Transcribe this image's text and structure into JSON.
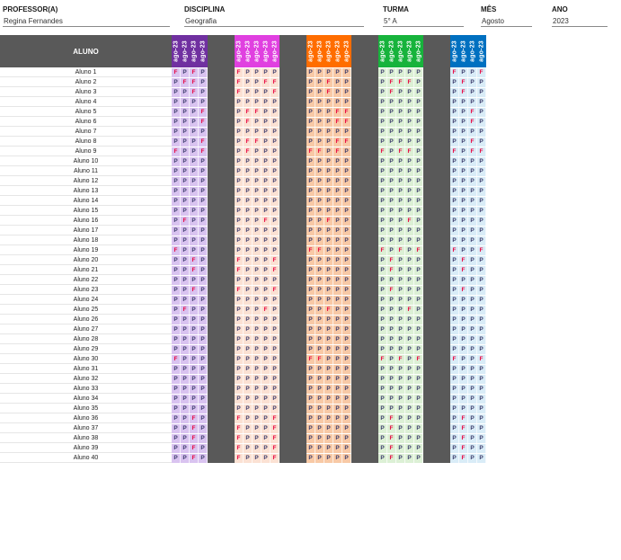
{
  "header": {
    "professor_label": "PROFESSOR(A)",
    "professor_value": "Regina Fernandes",
    "disciplina_label": "DISCIPLINA",
    "disciplina_value": "Geografia",
    "turma_label": "TURMA",
    "turma_value": "5° A",
    "mes_label": "MÊS",
    "mes_value": "Agosto",
    "ano_label": "ANO",
    "ano_value": "2023"
  },
  "grid": {
    "aluno_header": "ALUNO",
    "column_label": "ago-23",
    "groups": [
      {
        "header_color": "#7030a0",
        "cell_color": "#d9c3f0",
        "cols": 4
      },
      {
        "header_color": "#e040e0",
        "cell_color": "#fbe1d3",
        "cols": 5
      },
      {
        "header_color": "#ff6d00",
        "cell_color": "#f8c9a6",
        "cols": 5
      },
      {
        "header_color": "#17b33c",
        "cell_color": "#dcf0d5",
        "cols": 5
      },
      {
        "header_color": "#0070c0",
        "cell_color": "#d9ecf7",
        "cols": 4
      }
    ],
    "students": [
      {
        "name": "Aluno 1",
        "marks": [
          "FPFP",
          "FPPPP",
          "PPPPP",
          "PPPPP",
          "FPPF"
        ]
      },
      {
        "name": "Aluno 2",
        "marks": [
          "PFFP",
          "FPPFF",
          "PPFPP",
          "PFFFP",
          "PFPP"
        ]
      },
      {
        "name": "Aluno 3",
        "marks": [
          "PPFP",
          "FPPPF",
          "PPFPP",
          "PFPPP",
          "PFPP"
        ]
      },
      {
        "name": "Aluno 4",
        "marks": [
          "PPPP",
          "PPPPP",
          "PPPPP",
          "PPPPP",
          "PPPP"
        ]
      },
      {
        "name": "Aluno 5",
        "marks": [
          "PPPF",
          "PFFPP",
          "PPPFF",
          "PPPPP",
          "PPFP"
        ]
      },
      {
        "name": "Aluno 6",
        "marks": [
          "PPPF",
          "PFPPP",
          "PPPFF",
          "PPPPP",
          "PPFP"
        ]
      },
      {
        "name": "Aluno 7",
        "marks": [
          "PPPP",
          "PPPPP",
          "PPPPP",
          "PPPPP",
          "PPPP"
        ]
      },
      {
        "name": "Aluno 8",
        "marks": [
          "PPPF",
          "PFFPP",
          "PPPFF",
          "PPPPP",
          "PPFP"
        ]
      },
      {
        "name": "Aluno 9",
        "marks": [
          "FPPF",
          "PFPPP",
          "FFPFP",
          "FPFFP",
          "FPFF"
        ]
      },
      {
        "name": "Aluno 10",
        "marks": [
          "PPPP",
          "PPPPP",
          "PPPPP",
          "PPPPP",
          "PPPP"
        ]
      },
      {
        "name": "Aluno 11",
        "marks": [
          "PPPP",
          "PPPPP",
          "PPPPP",
          "PPPPP",
          "PPPP"
        ]
      },
      {
        "name": "Aluno 12",
        "marks": [
          "PPPP",
          "PPPPP",
          "PPPPP",
          "PPPPP",
          "PPPP"
        ]
      },
      {
        "name": "Aluno 13",
        "marks": [
          "PPPP",
          "PPPPP",
          "PPPPP",
          "PPPPP",
          "PPPP"
        ]
      },
      {
        "name": "Aluno 14",
        "marks": [
          "PPPP",
          "PPPPP",
          "PPPPP",
          "PPPPP",
          "PPPP"
        ]
      },
      {
        "name": "Aluno 15",
        "marks": [
          "PPPP",
          "PPPPP",
          "PPPPP",
          "PPPPP",
          "PPPP"
        ]
      },
      {
        "name": "Aluno 16",
        "marks": [
          "PFPP",
          "PPPFP",
          "PPFPP",
          "PPPFP",
          "PPPP"
        ]
      },
      {
        "name": "Aluno 17",
        "marks": [
          "PPPP",
          "PPPPP",
          "PPPPP",
          "PPPPP",
          "PPPP"
        ]
      },
      {
        "name": "Aluno 18",
        "marks": [
          "PPPP",
          "PPPPP",
          "PPPPP",
          "PPPPP",
          "PPPP"
        ]
      },
      {
        "name": "Aluno 19",
        "marks": [
          "FPPP",
          "PPPPP",
          "FFPPP",
          "FPFPF",
          "FPPF"
        ]
      },
      {
        "name": "Aluno 20",
        "marks": [
          "PPFP",
          "FPPPF",
          "PPPPP",
          "PFPPP",
          "PFPP"
        ]
      },
      {
        "name": "Aluno 21",
        "marks": [
          "PPFP",
          "FPPPF",
          "PPPPP",
          "PFPPP",
          "PFPP"
        ]
      },
      {
        "name": "Aluno 22",
        "marks": [
          "PPPP",
          "PPPPP",
          "PPPPP",
          "PPPPP",
          "PPPP"
        ]
      },
      {
        "name": "Aluno 23",
        "marks": [
          "PPFP",
          "FPPPF",
          "PPPPP",
          "PFPPP",
          "PFPP"
        ]
      },
      {
        "name": "Aluno 24",
        "marks": [
          "PPPP",
          "PPPPP",
          "PPPPP",
          "PPPPP",
          "PPPP"
        ]
      },
      {
        "name": "Aluno 25",
        "marks": [
          "PFPP",
          "PPPFP",
          "PPFPP",
          "PPPFP",
          "PPPP"
        ]
      },
      {
        "name": "Aluno 26",
        "marks": [
          "PPPP",
          "PPPPP",
          "PPPPP",
          "PPPPP",
          "PPPP"
        ]
      },
      {
        "name": "Aluno 27",
        "marks": [
          "PPPP",
          "PPPPP",
          "PPPPP",
          "PPPPP",
          "PPPP"
        ]
      },
      {
        "name": "Aluno 28",
        "marks": [
          "PPPP",
          "PPPPP",
          "PPPPP",
          "PPPPP",
          "PPPP"
        ]
      },
      {
        "name": "Aluno 29",
        "marks": [
          "PPPP",
          "PPPPP",
          "PPPPP",
          "PPPPP",
          "PPPP"
        ]
      },
      {
        "name": "Aluno 30",
        "marks": [
          "FPPP",
          "PPPPP",
          "FFPPP",
          "FPFPF",
          "FPPF"
        ]
      },
      {
        "name": "Aluno 31",
        "marks": [
          "PPPP",
          "PPPPP",
          "PPPPP",
          "PPPPP",
          "PPPP"
        ]
      },
      {
        "name": "Aluno 32",
        "marks": [
          "PPPP",
          "PPPPP",
          "PPPPP",
          "PPPPP",
          "PPPP"
        ]
      },
      {
        "name": "Aluno 33",
        "marks": [
          "PPPP",
          "PPPPP",
          "PPPPP",
          "PPPPP",
          "PPPP"
        ]
      },
      {
        "name": "Aluno 34",
        "marks": [
          "PPPP",
          "PPPPP",
          "PPPPP",
          "PPPPP",
          "PPPP"
        ]
      },
      {
        "name": "Aluno 35",
        "marks": [
          "PPPP",
          "PPPPP",
          "PPPPP",
          "PPPPP",
          "PPPP"
        ]
      },
      {
        "name": "Aluno 36",
        "marks": [
          "PPFP",
          "FPPPF",
          "PPPPP",
          "PFPPP",
          "PFPP"
        ]
      },
      {
        "name": "Aluno 37",
        "marks": [
          "PPFP",
          "FPPPF",
          "PPPPP",
          "PFPPP",
          "PFPP"
        ]
      },
      {
        "name": "Aluno 38",
        "marks": [
          "PPFP",
          "FPPPF",
          "PPPPP",
          "PFPPP",
          "PFPP"
        ]
      },
      {
        "name": "Aluno 39",
        "marks": [
          "PPFP",
          "FPPPF",
          "PPPPP",
          "PFPPP",
          "PFPP"
        ]
      },
      {
        "name": "Aluno 40",
        "marks": [
          "PPFP",
          "FPPPF",
          "PPPPP",
          "PFPPP",
          "PFPP"
        ]
      }
    ]
  }
}
